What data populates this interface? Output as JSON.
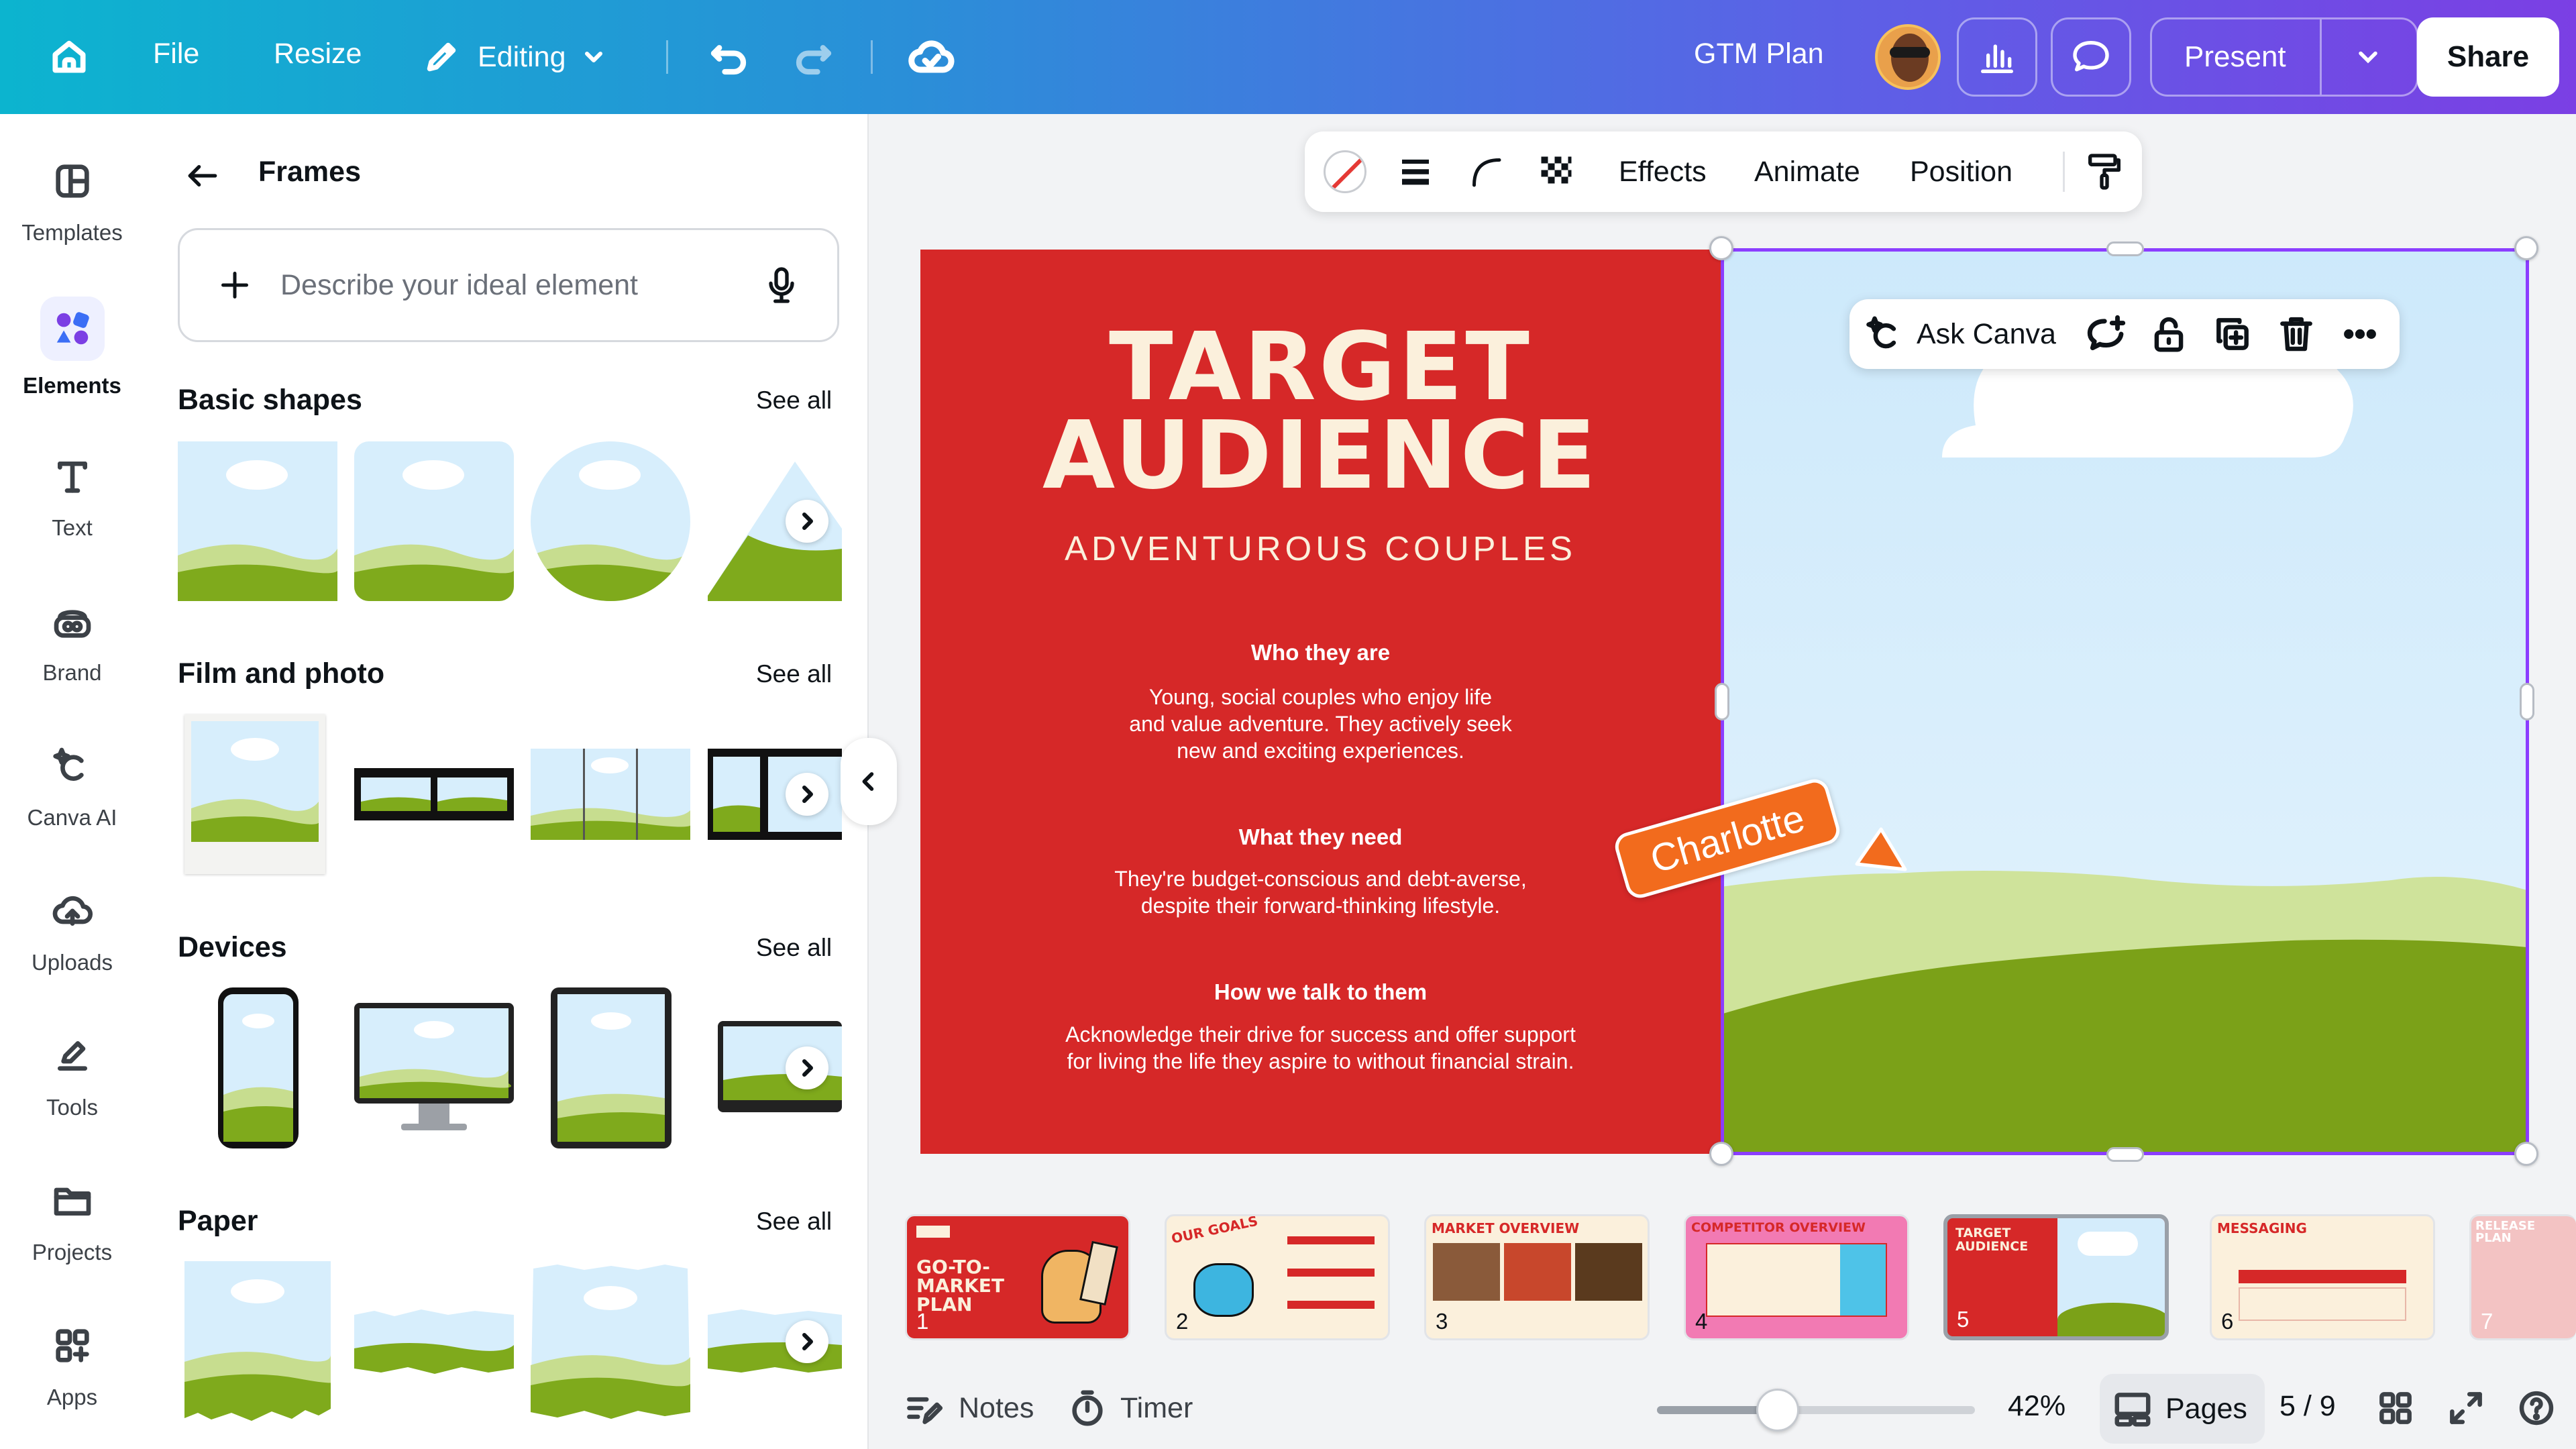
{
  "topbar": {
    "file": "File",
    "resize": "Resize",
    "editing": "Editing",
    "doc_title": "GTM Plan",
    "present": "Present",
    "share": "Share"
  },
  "rail": {
    "items": [
      {
        "label": "Templates",
        "icon": "templates-icon"
      },
      {
        "label": "Elements",
        "icon": "elements-icon"
      },
      {
        "label": "Text",
        "icon": "text-icon"
      },
      {
        "label": "Brand",
        "icon": "brand-icon"
      },
      {
        "label": "Canva AI",
        "icon": "canva-ai-icon"
      },
      {
        "label": "Uploads",
        "icon": "uploads-icon"
      },
      {
        "label": "Tools",
        "icon": "tools-icon"
      },
      {
        "label": "Projects",
        "icon": "projects-icon"
      },
      {
        "label": "Apps",
        "icon": "apps-icon"
      }
    ]
  },
  "panel": {
    "title": "Frames",
    "search_placeholder": "Describe your ideal element",
    "sections": [
      {
        "title": "Basic shapes",
        "see_all": "See all"
      },
      {
        "title": "Film and photo",
        "see_all": "See all"
      },
      {
        "title": "Devices",
        "see_all": "See all"
      },
      {
        "title": "Paper",
        "see_all": "See all"
      }
    ]
  },
  "toolbar": {
    "effects": "Effects",
    "animate": "Animate",
    "position": "Position"
  },
  "askbar": {
    "label": "Ask Canva"
  },
  "slide": {
    "title_line1": "TARGET",
    "title_line2": "AUDIENCE",
    "subtitle": "ADVENTUROUS COUPLES",
    "blocks": [
      {
        "heading": "Who they are",
        "body1": "Young, social couples who enjoy life",
        "body2": "and value adventure. They actively seek",
        "body3": "new and exciting experiences."
      },
      {
        "heading": "What they need",
        "body1": "They're budget-conscious and debt-averse,",
        "body2": "despite their forward-thinking lifestyle.",
        "body3": ""
      },
      {
        "heading": "How we talk to them",
        "body1": "Acknowledge their drive for success and offer support",
        "body2": "for living the life they aspire to without financial strain.",
        "body3": ""
      }
    ],
    "collaborator": "Charlotte"
  },
  "pages": [
    {
      "num": "1",
      "label": "GO-TO-MARKET PLAN"
    },
    {
      "num": "2",
      "label": "OUR GOALS"
    },
    {
      "num": "3",
      "label": "MARKET OVERVIEW"
    },
    {
      "num": "4",
      "label": "COMPETITOR OVERVIEW"
    },
    {
      "num": "5",
      "label": "TARGET AUDIENCE"
    },
    {
      "num": "6",
      "label": "MESSAGING"
    },
    {
      "num": "7",
      "label": "RELEASE PLAN"
    }
  ],
  "bottombar": {
    "notes": "Notes",
    "timer": "Timer",
    "zoom": "42%",
    "zoom_fraction": 0.38,
    "pages_label": "Pages",
    "page_count": "5 / 9"
  },
  "colors": {
    "slide_red": "#d62828",
    "accent_purple": "#8b3dff",
    "collab_orange": "#f26b1d"
  }
}
